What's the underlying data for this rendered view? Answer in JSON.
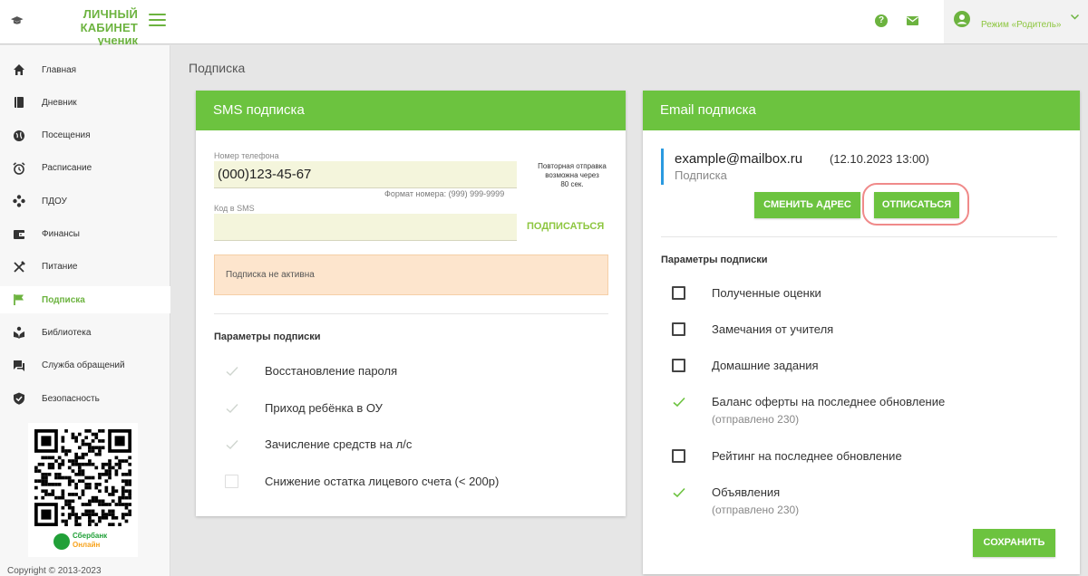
{
  "header": {
    "logo_line1": "ЛИЧНЫЙ КАБИНЕТ",
    "logo_line2": "ученик",
    "help_glyph": "?",
    "user_mode": "Режим «Родитель»",
    "accent_color": "#6cb33f"
  },
  "sidebar": {
    "items": [
      {
        "label": "Главная",
        "icon": "home-icon"
      },
      {
        "label": "Дневник",
        "icon": "book-icon"
      },
      {
        "label": "Посещения",
        "icon": "globe-icon"
      },
      {
        "label": "Расписание",
        "icon": "alarm-clock-icon"
      },
      {
        "label": "ПДОУ",
        "icon": "dots-icon"
      },
      {
        "label": "Финансы",
        "icon": "wallet-icon"
      },
      {
        "label": "Питание",
        "icon": "fork-knife-icon"
      },
      {
        "label": "Подписка",
        "icon": "flag-icon"
      },
      {
        "label": "Библиотека",
        "icon": "reader-icon"
      },
      {
        "label": "Служба обращений",
        "icon": "chat-icon"
      },
      {
        "label": "Безопасность",
        "icon": "shield-check-icon"
      }
    ],
    "active_index": 7,
    "sber_line1": "Сбербанк",
    "sber_line2": "Онлайн",
    "copyright": "Copyright © 2013-2023"
  },
  "page": {
    "title": "Подписка"
  },
  "sms": {
    "title": "SMS подписка",
    "phone_label": "Номер телефона",
    "phone_value": "(000)123-45-67",
    "phone_hint": "Формат номера: (999) 999-9999",
    "resend_line1": "Повторная отправка",
    "resend_line2": "возможна через",
    "resend_line3": "80 сек.",
    "code_label": "Код в SMS",
    "code_value": "",
    "subscribe_label": "ПОДПИСАТЬСЯ",
    "status_text": "Подписка не активна",
    "params_title": "Параметры подписки",
    "options": [
      {
        "label": "Восстановление пароля",
        "checked": true
      },
      {
        "label": "Приход ребёнка в ОУ",
        "checked": true
      },
      {
        "label": "Зачисление средств на л/с",
        "checked": true
      },
      {
        "label": "Снижение остатка лицевого счета (< 200р)",
        "checked": false
      }
    ]
  },
  "email": {
    "title": "Email подписка",
    "address": "example@mailbox.ru",
    "date": "(12.10.2023 13:00)",
    "subtitle": "Подписка",
    "change_label": "СМЕНИТЬ АДРЕС",
    "unsubscribe_label": "ОТПИСАТЬСЯ",
    "params_title": "Параметры подписки",
    "options": [
      {
        "label": "Полученные оценки",
        "checked": false,
        "sub": ""
      },
      {
        "label": "Замечания от учителя",
        "checked": false,
        "sub": ""
      },
      {
        "label": "Домашние задания",
        "checked": false,
        "sub": ""
      },
      {
        "label": "Баланс оферты на последнее обновление",
        "checked": true,
        "sub": "(отправлено 230)"
      },
      {
        "label": "Рейтинг на последнее обновление",
        "checked": false,
        "sub": ""
      },
      {
        "label": "Объявления",
        "checked": true,
        "sub": "(отправлено 230)"
      }
    ],
    "save_label": "СОХРАНИТЬ"
  }
}
